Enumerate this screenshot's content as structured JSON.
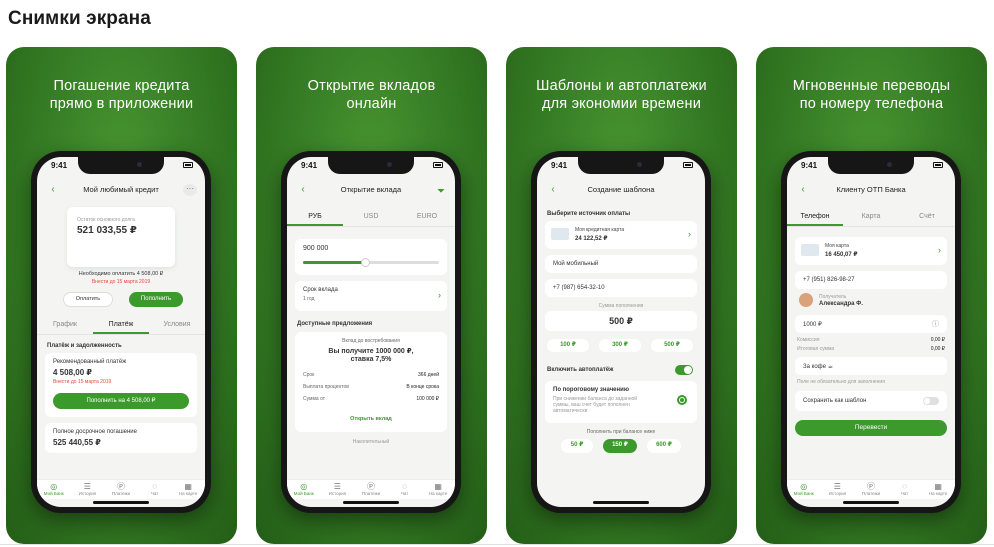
{
  "page": {
    "title": "Снимки экрана"
  },
  "status_time": "9:41",
  "nav": {
    "items": [
      "Мой Банк",
      "История",
      "Платежи",
      "Чат",
      "На карте"
    ]
  },
  "cards": [
    {
      "caption": [
        "Погашение кредита",
        "прямо в приложении"
      ],
      "header": "Мой любимый кредит",
      "balance_label": "Остаток основного долга",
      "balance": "521 033,55 ₽",
      "due_label": "Необходимо оплатить 4 508,00 ₽",
      "due_date": "Внести до 15 марта 2019",
      "btn_pay": "Оплатить",
      "btn_fill": "Пополнить",
      "tabs": [
        "График",
        "Платёж",
        "Условия"
      ],
      "section": "Платёж и задолженность",
      "rec_label": "Рекомендованный платёж",
      "rec_value": "4 508,00 ₽",
      "rec_date": "Внести до 15 марта 2019",
      "rec_btn": "Пополнить на 4 508,00 ₽",
      "full_label": "Полное досрочное погашение",
      "full_value": "525 440,55 ₽"
    },
    {
      "caption": [
        "Открытие вкладов",
        "онлайн"
      ],
      "header": "Открытие вклада",
      "tabs": [
        "РУБ",
        "USD",
        "EURO"
      ],
      "amount": "900 000",
      "term_label": "Срок вклада",
      "term_value": "1 год",
      "section": "Доступные предложения",
      "offer_title": "Вклад до востребования",
      "offer_line1": "Вы получите 1000 000 ₽,",
      "offer_line2": "ставка 7,5%",
      "rows": [
        [
          "Срок",
          "366 дней"
        ],
        [
          "Выплата процентов",
          "В конце срока"
        ],
        [
          "Сумма от",
          "100 000 ₽"
        ]
      ],
      "open_btn": "Открыть вклад",
      "next_label": "Накопительный"
    },
    {
      "caption": [
        "Шаблоны и автоплатежи",
        "для экономии времени"
      ],
      "header": "Создание шаблона",
      "source_label": "Выберите источник оплаты",
      "card_name": "Моя кредитная карта",
      "card_amount": "24 122,52 ₽",
      "field1": "Мой мобильный",
      "field2": "+7 (987) 654-32-10",
      "sum_label": "Сумма пополнения",
      "sum_value": "500 ₽",
      "chips": [
        "100 ₽",
        "300 ₽",
        "500 ₽"
      ],
      "auto_label": "Включить автоплатёж",
      "threshold_title": "По пороговому значению",
      "threshold_desc": "При снижении баланса до заданной суммы, ваш счет будет пополнен автоматически",
      "threshold_label": "Пополнить при балансе ниже",
      "chips2": [
        "50 ₽",
        "150 ₽",
        "600 ₽"
      ]
    },
    {
      "caption": [
        "Мгновенные переводы",
        "по номеру телефона"
      ],
      "header": "Клиенту ОТП Банка",
      "tabs": [
        "Телефон",
        "Карта",
        "Счёт"
      ],
      "card_name": "Моя карта",
      "card_amount": "16 450,07 ₽",
      "phone": "+7 (951) 826-98-27",
      "recipient_label": "Получатель",
      "recipient_name": "Александра Ф.",
      "amount": "1000 ₽",
      "fee_label": "Комиссия",
      "fee_value": "0,00 ₽",
      "total_label": "Итоговая сумма",
      "total_value": "0,00 ₽",
      "comment": "За кофе ☕",
      "comment_hint": "Поле не обязательно для заполнения",
      "save_label": "Сохранить как шаблон",
      "send_btn": "Перевести"
    }
  ]
}
